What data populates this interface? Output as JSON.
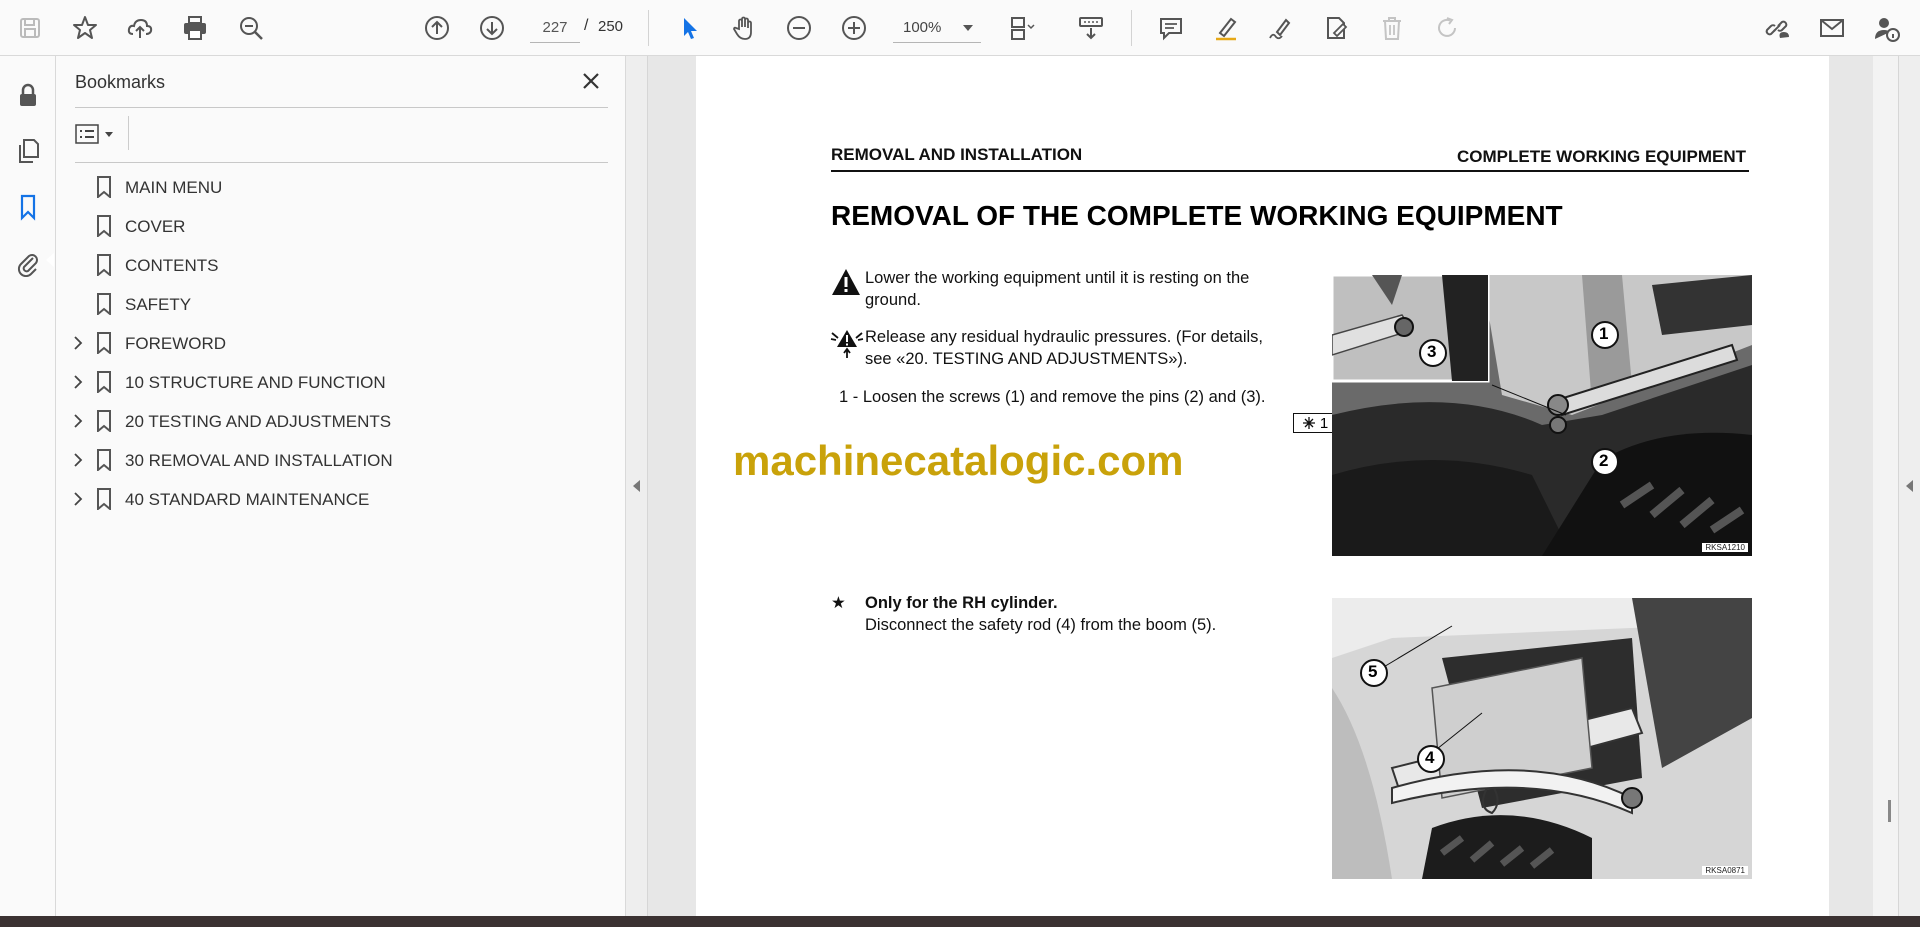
{
  "toolbar": {
    "current_page": "227",
    "page_separator": "/",
    "total_pages": "250",
    "zoom": "100%"
  },
  "bookmarks": {
    "title": "Bookmarks",
    "items": [
      {
        "label": "MAIN MENU",
        "expandable": false
      },
      {
        "label": "COVER",
        "expandable": false
      },
      {
        "label": "CONTENTS",
        "expandable": false
      },
      {
        "label": "SAFETY",
        "expandable": false
      },
      {
        "label": "FOREWORD",
        "expandable": true
      },
      {
        "label": "10 STRUCTURE AND FUNCTION",
        "expandable": true
      },
      {
        "label": "20 TESTING AND ADJUSTMENTS",
        "expandable": true
      },
      {
        "label": "30 REMOVAL AND INSTALLATION",
        "expandable": true
      },
      {
        "label": "40 STANDARD MAINTENANCE",
        "expandable": true
      }
    ]
  },
  "document": {
    "header_left": "REMOVAL AND INSTALLATION",
    "header_right": "COMPLETE WORKING EQUIPMENT",
    "title": "REMOVAL OF THE COMPLETE WORKING EQUIPMENT",
    "warning_line1": "Lower the working equipment until it is resting on the",
    "warning_line2": "ground.",
    "pressure_line1": "Release any residual hydraulic pressures. (For details,",
    "pressure_line2": "see «20. TESTING AND ADJUSTMENTS»).",
    "step1": "1 - Loosen the screws (1) and remove the pins (2) and (3).",
    "ref_number": "1",
    "star_symbol": "★",
    "note_bold": "Only for the RH cylinder.",
    "note_text": "Disconnect the safety rod (4) from the boom (5).",
    "photo1_code": "RKSA1210",
    "photo2_code": "RKSA0871",
    "callouts": {
      "c1": "1",
      "c2": "2",
      "c3": "3",
      "c4": "4",
      "c5": "5"
    }
  },
  "watermark": "machinecatalogic.com",
  "colors": {
    "accent_blue": "#1473e6",
    "watermark": "#c9a20a"
  }
}
